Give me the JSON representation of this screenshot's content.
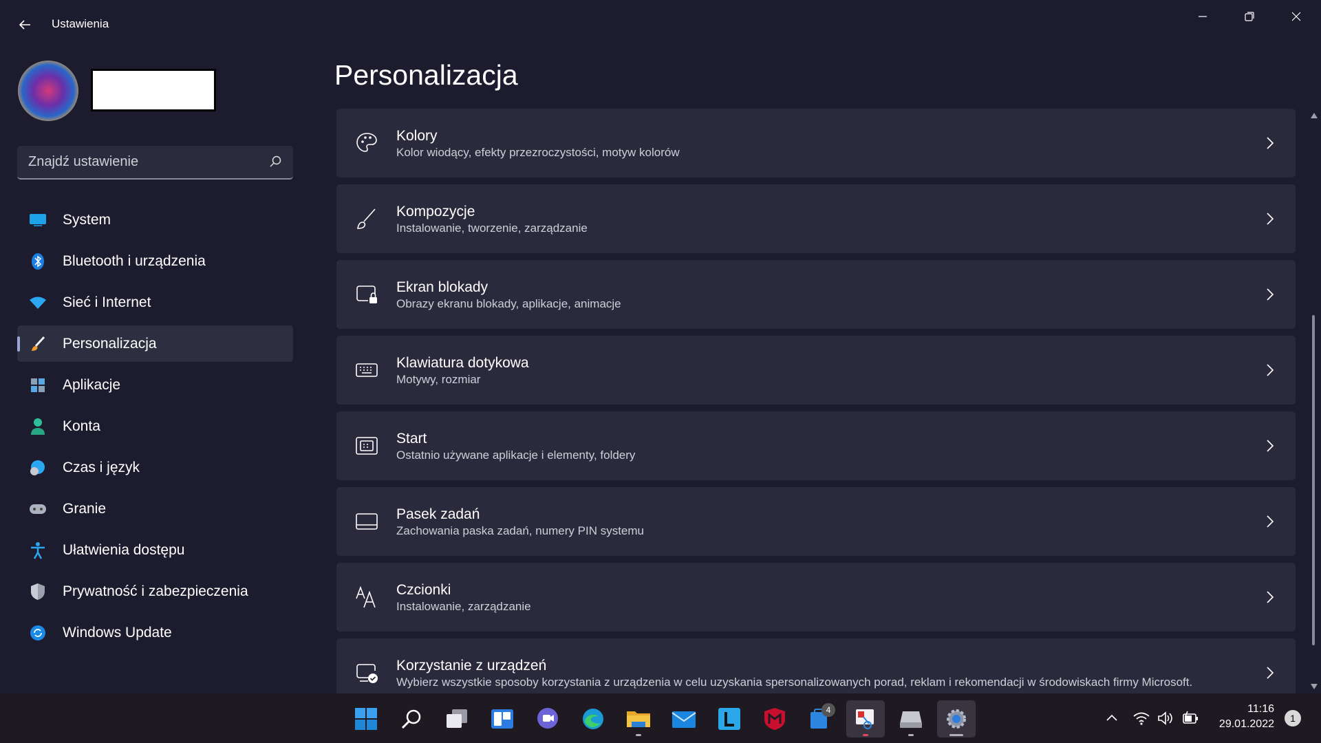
{
  "window": {
    "title": "Ustawienia"
  },
  "search": {
    "placeholder": "Znajdź ustawienie"
  },
  "sidebar": {
    "items": [
      {
        "label": "System",
        "icon": "monitor-icon"
      },
      {
        "label": "Bluetooth i urządzenia",
        "icon": "bluetooth-icon"
      },
      {
        "label": "Sieć i Internet",
        "icon": "wifi-icon"
      },
      {
        "label": "Personalizacja",
        "icon": "brush-icon",
        "active": true
      },
      {
        "label": "Aplikacje",
        "icon": "apps-icon"
      },
      {
        "label": "Konta",
        "icon": "person-icon"
      },
      {
        "label": "Czas i język",
        "icon": "globe-clock-icon"
      },
      {
        "label": "Granie",
        "icon": "gamepad-icon"
      },
      {
        "label": "Ułatwienia dostępu",
        "icon": "accessibility-icon"
      },
      {
        "label": "Prywatność i zabezpieczenia",
        "icon": "shield-icon"
      },
      {
        "label": "Windows Update",
        "icon": "update-icon"
      }
    ]
  },
  "main": {
    "title": "Personalizacja",
    "cards": [
      {
        "title": "Kolory",
        "subtitle": "Kolor wiodący, efekty przezroczystości, motyw kolorów",
        "icon": "palette-icon"
      },
      {
        "title": "Kompozycje",
        "subtitle": "Instalowanie, tworzenie, zarządzanie",
        "icon": "brush-icon"
      },
      {
        "title": "Ekran blokady",
        "subtitle": "Obrazy ekranu blokady, aplikacje, animacje",
        "icon": "lock-screen-icon"
      },
      {
        "title": "Klawiatura dotykowa",
        "subtitle": "Motywy, rozmiar",
        "icon": "keyboard-icon"
      },
      {
        "title": "Start",
        "subtitle": "Ostatnio używane aplikacje i elementy, foldery",
        "icon": "start-icon"
      },
      {
        "title": "Pasek zadań",
        "subtitle": "Zachowania paska zadań, numery PIN systemu",
        "icon": "taskbar-icon"
      },
      {
        "title": "Czcionki",
        "subtitle": "Instalowanie, zarządzanie",
        "icon": "fonts-icon"
      },
      {
        "title": "Korzystanie z urządzeń",
        "subtitle": "Wybierz wszystkie sposoby korzystania z urządzenia w celu uzyskania spersonalizowanych porad, reklam i rekomendacji w środowiskach firmy Microsoft.",
        "icon": "device-usage-icon"
      }
    ]
  },
  "taskbar": {
    "apps": [
      "start-icon",
      "search-icon",
      "task-view-icon",
      "widgets-icon",
      "chat-icon",
      "edge-icon",
      "file-explorer-icon",
      "mail-icon",
      "l-app-icon",
      "mcafee-icon",
      "store-icon",
      "snipping-tool-icon",
      "drive-icon",
      "settings-gear-icon"
    ],
    "store_badge": "4",
    "time": "11:16",
    "date": "29.01.2022",
    "notification_count": "1"
  },
  "colors": {
    "background": "#1c1c2e",
    "card": "#2a2a3c",
    "accent": "#9aa6d6"
  }
}
